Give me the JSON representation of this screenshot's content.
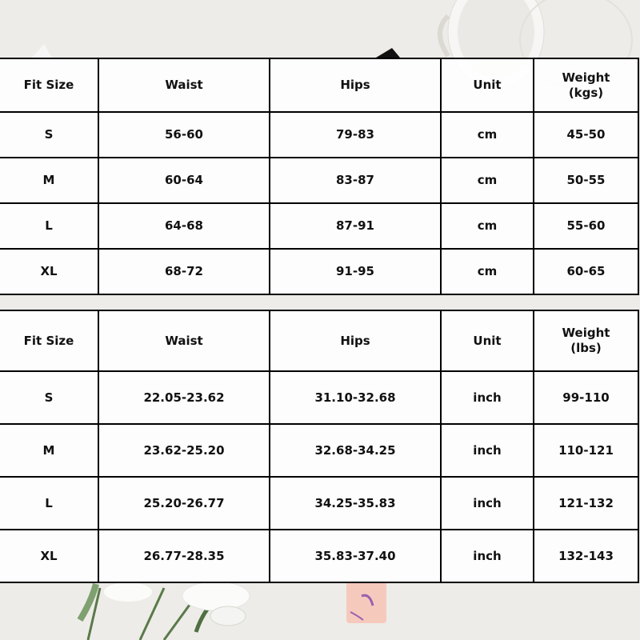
{
  "tables": [
    {
      "headers": [
        "Fit Size",
        "Waist",
        "Hips",
        "Unit",
        "Weight",
        "(kgs)"
      ],
      "rows": [
        {
          "size": "S",
          "waist": "56-60",
          "hips": "79-83",
          "unit": "cm",
          "weight": "45-50"
        },
        {
          "size": "M",
          "waist": "60-64",
          "hips": "83-87",
          "unit": "cm",
          "weight": "50-55"
        },
        {
          "size": "L",
          "waist": "64-68",
          "hips": "87-91",
          "unit": "cm",
          "weight": "55-60"
        },
        {
          "size": "XL",
          "waist": "68-72",
          "hips": "91-95",
          "unit": "cm",
          "weight": "60-65"
        }
      ]
    },
    {
      "headers": [
        "Fit Size",
        "Waist",
        "Hips",
        "Unit",
        "Weight",
        "(lbs)"
      ],
      "rows": [
        {
          "size": "S",
          "waist": "22.05-23.62",
          "hips": "31.10-32.68",
          "unit": "inch",
          "weight": "99-110"
        },
        {
          "size": "M",
          "waist": "23.62-25.20",
          "hips": "32.68-34.25",
          "unit": "inch",
          "weight": "110-121"
        },
        {
          "size": "L",
          "waist": "25.20-26.77",
          "hips": "34.25-35.83",
          "unit": "inch",
          "weight": "121-132"
        },
        {
          "size": "XL",
          "waist": "26.77-28.35",
          "hips": "35.83-37.40",
          "unit": "inch",
          "weight": "132-143"
        }
      ]
    }
  ],
  "colors": {
    "border": "#000000",
    "text": "#111111",
    "background": "#eeece8",
    "ribbon": "#f6c9bd",
    "leaf": "#5a7a4a"
  }
}
